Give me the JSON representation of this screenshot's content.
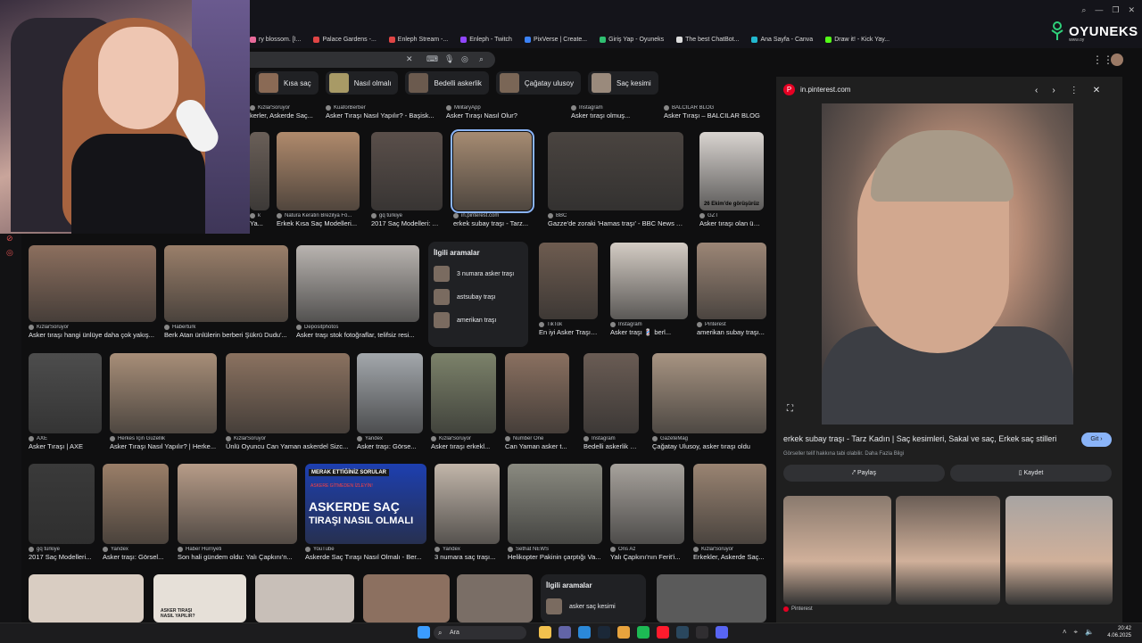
{
  "bookmarks": [
    {
      "label": "ry blossom. [I...",
      "color": "#e86a9a"
    },
    {
      "label": "Palace Gardens -...",
      "color": "#e04545"
    },
    {
      "label": "Enleph Stream -...",
      "color": "#e04545"
    },
    {
      "label": "Enleph - Twitch",
      "color": "#9146ff"
    },
    {
      "label": "PixVerse | Create...",
      "color": "#3b82f6"
    },
    {
      "label": "Giriş Yap - Oyuneks",
      "color": "#2fbf71"
    },
    {
      "label": "The best ChatBot...",
      "color": "#dddddd"
    },
    {
      "label": "Ana Sayfa - Canva",
      "color": "#22b8cf"
    },
    {
      "label": "Draw it! - Kick Yay...",
      "color": "#53fc18"
    }
  ],
  "logo": {
    "name": "OYUNEKS",
    "sub": "www.oy"
  },
  "chips": [
    {
      "label": "Kısa saç",
      "color": "#8a6a55"
    },
    {
      "label": "Nasıl olmalı",
      "color": "#a89a66"
    },
    {
      "label": "Bedelli askerlik",
      "color": "#6b5a4e"
    },
    {
      "label": "Çağatay ulusoy",
      "color": "#7a6656"
    },
    {
      "label": "Saç kesimi",
      "color": "#9a8a7c"
    }
  ],
  "row0": [
    {
      "src": "KizlarSoruyor",
      "title": "kerler, Askerde Saç...",
      "color": "#5a5a5a"
    },
    {
      "src": "KuaforBerber",
      "title": "Asker Tıraşı Nasıl Yapılır? - Başisk...",
      "color": "#5a5a5a"
    },
    {
      "src": "MilitaryApp",
      "title": "Asker Tıraşı Nasıl Olur?",
      "color": "#5a5a5a"
    },
    {
      "src": "Instagram",
      "title": "Asker tıraşı olmuş...",
      "color": "#5a5a5a"
    },
    {
      "src": "BALCILAR BLOG",
      "title": "Asker Tıraşı – BALCILAR BLOG",
      "color": "#5a5a5a"
    }
  ],
  "row1": [
    {
      "src": "k",
      "title": "Ya...",
      "color": "#6a5f58"
    },
    {
      "src": "Natura Keratin Brezilya Fö...",
      "title": "Erkek Kısa Saç Modelleri...",
      "color": "#b08a6c"
    },
    {
      "src": "gq türkiye",
      "title": "2017 Saç Modelleri: As...",
      "color": "#5a4f4a"
    },
    {
      "src": "in.pinterest.com",
      "title": "erkek subay traşı - Tarz...",
      "color": "#a68b72"
    },
    {
      "src": "BBC",
      "title": "Gazze'de zoraki 'Hamas traşı' - BBC News Tür...",
      "color": "#4a4440"
    },
    {
      "src": "GZT",
      "title": "Asker tıraşı olan ünlü...",
      "color": "#d9d4d0"
    }
  ],
  "row2": [
    {
      "src": "KizlarSoruyor",
      "title": "Asker tıraşı hangi ünlüye daha çok yakış...",
      "color": "#8c6f5e"
    },
    {
      "src": "Haberturk",
      "title": "Berk Atan ünlülerin berberi Şükrü Dudu'...",
      "color": "#9a7f6a"
    },
    {
      "src": "Depositphotos",
      "title": "Asker traşı stok fotoğraflar, telifsiz resi...",
      "color": "#b9b4b0"
    },
    {
      "src": "TikTok",
      "title": "En iyi Asker Traşı | ...",
      "color": "#6e5c50"
    },
    {
      "src": "Instagram",
      "title": "Asker traşı 💈 berl...",
      "color": "#d4ccc4"
    },
    {
      "src": "Pinterest",
      "title": "amerikan subay traşı...",
      "color": "#9c8676"
    }
  ],
  "related1": {
    "heading": "İlgili aramalar",
    "items": [
      {
        "label": "3 numara asker traşı"
      },
      {
        "label": "astsubay traşı"
      },
      {
        "label": "amerikan traşı"
      }
    ]
  },
  "row3": [
    {
      "src": "AXE",
      "title": "Asker Tıraşı | AXE",
      "color": "#4d4d4d"
    },
    {
      "src": "Herkes İçin Güzellik",
      "title": "Asker Tıraşı Nasıl Yapılır? | Herke...",
      "color": "#a88e78"
    },
    {
      "src": "KizlarSoruyor",
      "title": "Ünlü Oyuncu Can Yaman askerdel Sizc...",
      "color": "#8b7260"
    },
    {
      "src": "Yandex",
      "title": "Asker traşı: Görse...",
      "color": "#a3a8ac"
    },
    {
      "src": "KizlarSoruyor",
      "title": "Asker tıraşı erkekl...",
      "color": "#7c826a"
    },
    {
      "src": "Number One",
      "title": "Can Yaman asker t...",
      "color": "#8a7060"
    },
    {
      "src": "Instagram",
      "title": "Bedelli askerlik gör...",
      "color": "#6a5c54"
    },
    {
      "src": "GazeteMag",
      "title": "Çağatay Ulusoy, asker tıraşı oldu",
      "color": "#a89482"
    }
  ],
  "row4": [
    {
      "src": "gq türkiye",
      "title": "2017 Saç Modelleri...",
      "color": "#3a3a3a"
    },
    {
      "src": "Yandex",
      "title": "Asker traşı: Görsel...",
      "color": "#9a7e68"
    },
    {
      "src": "Haber Hürriyeti",
      "title": "Son hali gündem oldu: Yalı Çapkını'n...",
      "color": "#b79c88"
    },
    {
      "src": "YouTube",
      "title": "Askerde Saç Tıraşı Nasıl Olmalı - Ber...",
      "color": "#1d3fb0"
    },
    {
      "src": "Yandex",
      "title": "3 numara saç traşı...",
      "color": "#c2b6aa"
    },
    {
      "src": "Sethat NEWS",
      "title": "Helikopter Pakinin çarptığı Va...",
      "color": "#8a8a80"
    },
    {
      "src": "Ons Az",
      "title": "Yalı Çapkını'nın Ferit'i...",
      "color": "#a7a29c"
    },
    {
      "src": "KizlarSoruyor",
      "title": "Erkekler, Askerde Saç...",
      "color": "#9a8472"
    }
  ],
  "thumb_overlay": {
    "line1": "ASKERDE SAÇ",
    "line2": "TIRAŞI NASIL OLMALI",
    "top": "MERAK ETTİĞİNİZ SORULAR",
    "sub": "ASKERE GİTMEDEN İZLEYİN!"
  },
  "row5_colors": [
    "#d9cdc2",
    "#e6e0d8",
    "#c8bfb8",
    "#8c7060",
    "#7a6e66",
    "#5a5a5a"
  ],
  "row5_overlay": "ASKER TIRAŞI NASIL YAPILIR?",
  "related2": {
    "heading": "İlgili aramalar",
    "items": [
      {
        "label": "asker saç kesimi"
      }
    ]
  },
  "gzt_caption": "26 Ekim'de görüşürüz",
  "panel": {
    "domain": "in.pinterest.com",
    "title": "erkek subay traşı - Tarz Kadın | Saç kesimleri, Sakal ve saç, Erkek saç stilleri",
    "visit": "Git",
    "note": "Görseller telif hakkına tabi olabilir. Daha Fazla Bilgi",
    "share": "Paylaş",
    "save": "Kaydet",
    "thumb_source": "Pinterest",
    "thumbs": [
      "#8a7a6e",
      "#6b5e56",
      "#a8a4a2"
    ]
  },
  "taskbar": {
    "search": "Ara",
    "time": "20:42",
    "date": "4.06.2025",
    "icons": [
      {
        "name": "windows-start-icon",
        "color": "#3b9cff"
      },
      {
        "name": "file-explorer-icon",
        "color": "#f2c14e"
      },
      {
        "name": "chat-icon",
        "color": "#6264a7"
      },
      {
        "name": "widgets-icon",
        "color": "#2b88d8"
      },
      {
        "name": "steam-icon",
        "color": "#1b2838"
      },
      {
        "name": "chrome-icon",
        "color": "#e8a33d"
      },
      {
        "name": "spotify-icon",
        "color": "#1db954"
      },
      {
        "name": "opera-icon",
        "color": "#ff1b2d"
      },
      {
        "name": "steam-alt-icon",
        "color": "#2a475e"
      },
      {
        "name": "obs-icon",
        "color": "#302e31"
      },
      {
        "name": "discord-icon",
        "color": "#5865f2"
      }
    ]
  }
}
